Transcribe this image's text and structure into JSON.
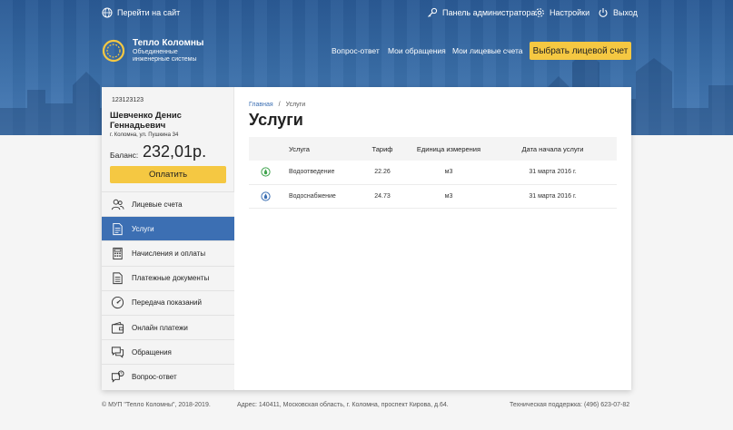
{
  "topbar": {
    "site_link": "Перейти на сайт",
    "admin_panel": "Панель администратора",
    "settings": "Настройки",
    "logout": "Выход"
  },
  "logo": {
    "name": "Тепло Коломны",
    "subtitle_line1": "Объединенные",
    "subtitle_line2": "инженерные системы"
  },
  "nav": {
    "faq": "Вопрос-ответ",
    "my_requests": "Мои обращения",
    "my_accounts": "Мои лицевые счета",
    "choose_account": "Выбрать лицевой счет"
  },
  "account": {
    "number": "123123123",
    "name": "Шевченко Денис Геннадьевич",
    "address": "г. Коломна, ул. Пушкина 34",
    "balance_label": "Баланс:",
    "balance_value": "232,01р.",
    "pay_button": "Оплатить"
  },
  "menu": [
    {
      "label": "Лицевые счета",
      "icon": "users-icon",
      "active": false
    },
    {
      "label": "Услуги",
      "icon": "document-icon",
      "active": true
    },
    {
      "label": "Начисления и оплаты",
      "icon": "calculator-icon",
      "active": false
    },
    {
      "label": "Платежные документы",
      "icon": "documents-icon",
      "active": false
    },
    {
      "label": "Передача показаний",
      "icon": "gauge-icon",
      "active": false
    },
    {
      "label": "Онлайн платежи",
      "icon": "wallet-icon",
      "active": false
    },
    {
      "label": "Обращения",
      "icon": "chat-icon",
      "active": false
    },
    {
      "label": "Вопрос-ответ",
      "icon": "question-chat-icon",
      "active": false
    }
  ],
  "breadcrumb": {
    "home": "Главная",
    "separator": "/",
    "current": "Услуги"
  },
  "page_title": "Услуги",
  "table": {
    "headers": [
      "Услуга",
      "Тариф",
      "Единица измерения",
      "Дата начала услуги"
    ],
    "rows": [
      {
        "icon": "drain-icon",
        "icon_color": "#3fa34d",
        "service": "Водоотведение",
        "tariff": "22.26",
        "unit": "м3",
        "start_date": "31 марта 2016 г."
      },
      {
        "icon": "water-drop-icon",
        "icon_color": "#3c6fb3",
        "service": "Водоснабжение",
        "tariff": "24.73",
        "unit": "м3",
        "start_date": "31 марта 2016 г."
      }
    ]
  },
  "footer": {
    "copyright": "© МУП \"Тепло Коломны\", 2018-2019.",
    "address": "Адрес: 140411, Московская область, г. Коломна, проспект Кирова, д.64.",
    "support": "Техническая поддержка: (496) 623-07-82"
  },
  "colors": {
    "accent_blue": "#3c6fb3",
    "button_yellow": "#f5c842",
    "header_blue": "#2f6199"
  }
}
